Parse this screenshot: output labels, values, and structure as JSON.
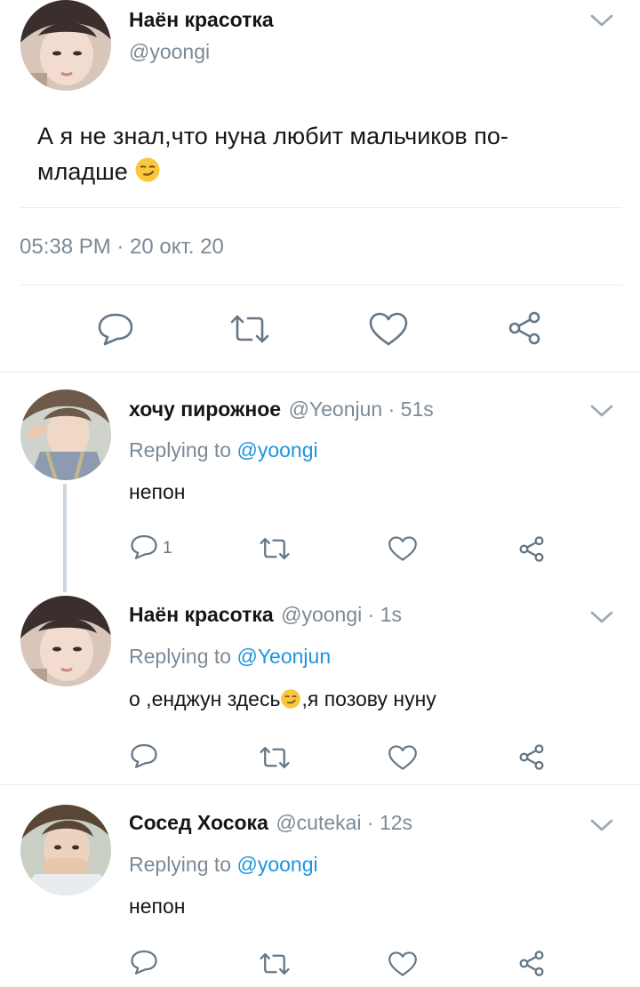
{
  "main_tweet": {
    "author_name": "Наён красотка",
    "author_handle": "@yoongi",
    "text_line1": "А я не знал,что нуна любит мальчиков по-",
    "text_line2": "младше",
    "text_emoji": "smirk-emoji",
    "timestamp": "05:38 PM · 20 окт. 20",
    "actions": [
      "reply-icon",
      "retweet-icon",
      "like-icon",
      "share-icon"
    ]
  },
  "replies": [
    {
      "author_name": "хочу пирожное",
      "author_handle": "@Yeonjun · 51s",
      "replying_prefix": "Replying to",
      "replying_to": "@yoongi",
      "text": "непон",
      "reply_count": "1"
    },
    {
      "author_name": "Наён красотка",
      "author_handle": "@yoongi · 1s",
      "replying_prefix": "Replying to",
      "replying_to": "@Yeonjun",
      "text_before": "о ,енджун здесь",
      "text_after": ",я позову нуну",
      "text_emoji": "smirk-emoji",
      "reply_count": ""
    },
    {
      "author_name": "Сосед Хосока",
      "author_handle": "@cutekai · 12s",
      "replying_prefix": "Replying to",
      "replying_to": "@yoongi",
      "text": "непон",
      "reply_count": ""
    }
  ],
  "colors": {
    "text": "#14171a",
    "secondary": "#7b8a96",
    "link": "#1b95e0",
    "divider": "#e6ecf0",
    "icon": "#657786"
  }
}
